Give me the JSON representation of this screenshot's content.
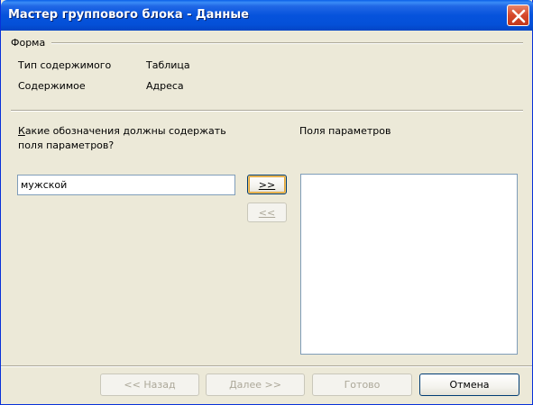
{
  "window": {
    "title": "Мастер группового блока - Данные"
  },
  "form_section": {
    "label": "Форма",
    "rows": [
      {
        "key": "Тип содержимого",
        "value": "Таблица"
      },
      {
        "key": "Содержимое",
        "value": "Адреса"
      }
    ]
  },
  "question": {
    "line1": "Какие обозначения должны содержать",
    "line2": "поля параметров?"
  },
  "input": {
    "value": "мужской"
  },
  "params": {
    "label": "Поля параметров"
  },
  "buttons": {
    "add": ">>",
    "remove": "<<",
    "back": "<< Назад",
    "next": "Далее >>",
    "finish": "Готово",
    "cancel": "Отмена"
  }
}
